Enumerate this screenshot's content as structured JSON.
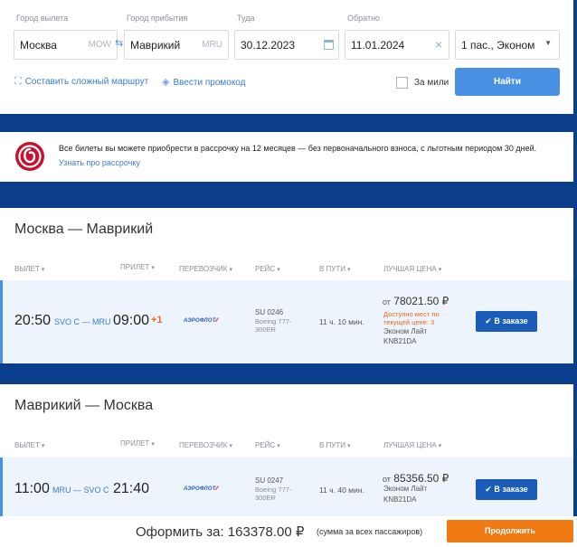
{
  "search": {
    "from_label": "Город вылета",
    "from_value": "Москва",
    "from_code": "MOW",
    "to_label": "Город прибытия",
    "to_value": "Маврикий",
    "to_code": "MRU",
    "depart_label": "Туда",
    "depart_value": "30.12.2023",
    "return_label": "Обратно",
    "return_value": "11.01.2024",
    "passengers_value": "1 пас., Эконом",
    "complex_route_link": "Составить сложный маршрут",
    "promo_link": "Ввести промокод",
    "miles_label": "За мили",
    "find_button": "Найти"
  },
  "installment": {
    "text": "Все билеты вы можете приобрести в рассрочку на 12 месяцев — без первоначального взноса, с льготным периодом 30 дней.",
    "link": "Узнать про рассрочку"
  },
  "columns": {
    "departure": "ВЫЛЕТ",
    "arrival": "ПРИЛЕТ",
    "carrier": "ПЕРЕВОЗЧИК",
    "flight": "РЕЙС",
    "duration": "В ПУТИ",
    "best_price": "ЛУЧШАЯ ЦЕНА"
  },
  "legs": [
    {
      "title": "Москва — Маврикий",
      "dep_time": "20:50",
      "route": "SVO C — MRU",
      "arr_time": "09:00",
      "plus_day": "+1",
      "airline": "АЭРОФЛОТ",
      "flight_number": "SU 0246",
      "aircraft": "Boeing 777-300ER",
      "duration": "11 ч. 10 мин.",
      "price_prefix": "от",
      "price": "78021.50 ₽",
      "availability": "Доступно мест по текущей цене: 3",
      "fare_name": "Эконом Лайт",
      "fare_code": "KNB21DA",
      "button": "В заказе"
    },
    {
      "title": "Маврикий — Москва",
      "dep_time": "11:00",
      "route": "MRU — SVO C",
      "arr_time": "21:40",
      "plus_day": "",
      "airline": "АЭРОФЛОТ",
      "flight_number": "SU 0247",
      "aircraft": "Boeing 777-300ER",
      "duration": "11 ч. 40 мин.",
      "price_prefix": "от",
      "price": "85356.50 ₽",
      "availability": "",
      "fare_name": "Эконом Лайт",
      "fare_code": "KNB21DA",
      "button": "В заказе"
    }
  ],
  "footer": {
    "total_label": "Оформить за:",
    "total_value": "163378.00 ₽",
    "total_note": "(сумма за всех пассажиров)",
    "continue_button": "Продолжить"
  },
  "colors": {
    "brand_blue": "#0a3d8b",
    "accent_blue": "#4a90e2",
    "orange": "#f07a14",
    "installment_logo": "#c8102e"
  }
}
